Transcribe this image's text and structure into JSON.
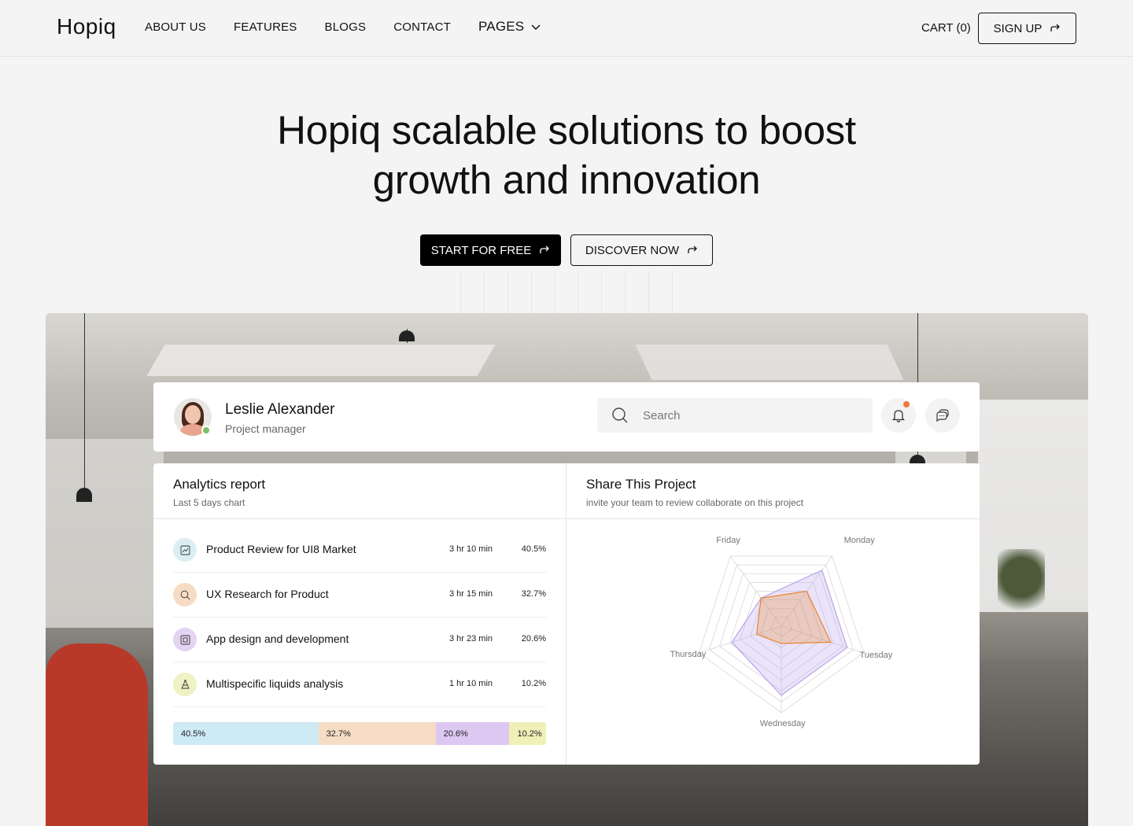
{
  "nav": {
    "logo": "Hopiq",
    "links": [
      "ABOUT US",
      "FEATURES",
      "BLOGS",
      "CONTACT"
    ],
    "pages_label": "PAGES",
    "cart": "CART (0)",
    "signup": "SIGN UP"
  },
  "hero": {
    "title_line1": "Hopiq scalable solutions to boost",
    "title_line2": "growth and innovation",
    "primary_btn": "START FOR FREE",
    "secondary_btn": "DISCOVER NOW"
  },
  "profile": {
    "name": "Leslie Alexander",
    "role": "Project manager",
    "search_placeholder": "Search"
  },
  "analytics": {
    "title": "Analytics report",
    "subtitle": "Last 5 days chart",
    "rows": [
      {
        "label": "Product Review for UI8 Market",
        "time": "3 hr 10 min",
        "pct": "40.5%",
        "color": "#dbeef3",
        "icon": "chart-icon"
      },
      {
        "label": "UX Research for Product",
        "time": "3 hr 15 min",
        "pct": "32.7%",
        "color": "#f6dcc4",
        "icon": "search-icon"
      },
      {
        "label": "App design and development",
        "time": "3 hr 23 min",
        "pct": "20.6%",
        "color": "#e4d3f3",
        "icon": "layers-icon"
      },
      {
        "label": "Multispecific liquids analysis",
        "time": "1 hr 10 min",
        "pct": "10.2%",
        "color": "#eef2c4",
        "icon": "flask-icon"
      }
    ],
    "bar": [
      {
        "label": "40.5%",
        "value": 40.5,
        "color": "#cdeaf5"
      },
      {
        "label": "32.7%",
        "value": 32.7,
        "color": "#f6dcc4"
      },
      {
        "label": "20.6%",
        "value": 20.6,
        "color": "#ddc8f2"
      },
      {
        "label": "10.2%",
        "value": 10.2,
        "color": "#eef0b8"
      }
    ]
  },
  "share": {
    "title": "Share This Project",
    "subtitle": "invite your team to review collaborate on this project"
  },
  "chart_data": {
    "type": "radar",
    "axes": [
      "Monday",
      "Tuesday",
      "Wednesday",
      "Thursday",
      "Friday"
    ],
    "max": 10,
    "series": [
      {
        "values": [
          8,
          8,
          8,
          6,
          4
        ],
        "color": "#b9a3ea"
      },
      {
        "values": [
          5,
          6,
          2,
          3,
          4
        ],
        "color": "#e8852e"
      }
    ]
  },
  "colors": {
    "accent": "#000000",
    "notif": "#f07a38",
    "online": "#7cbf6b"
  }
}
